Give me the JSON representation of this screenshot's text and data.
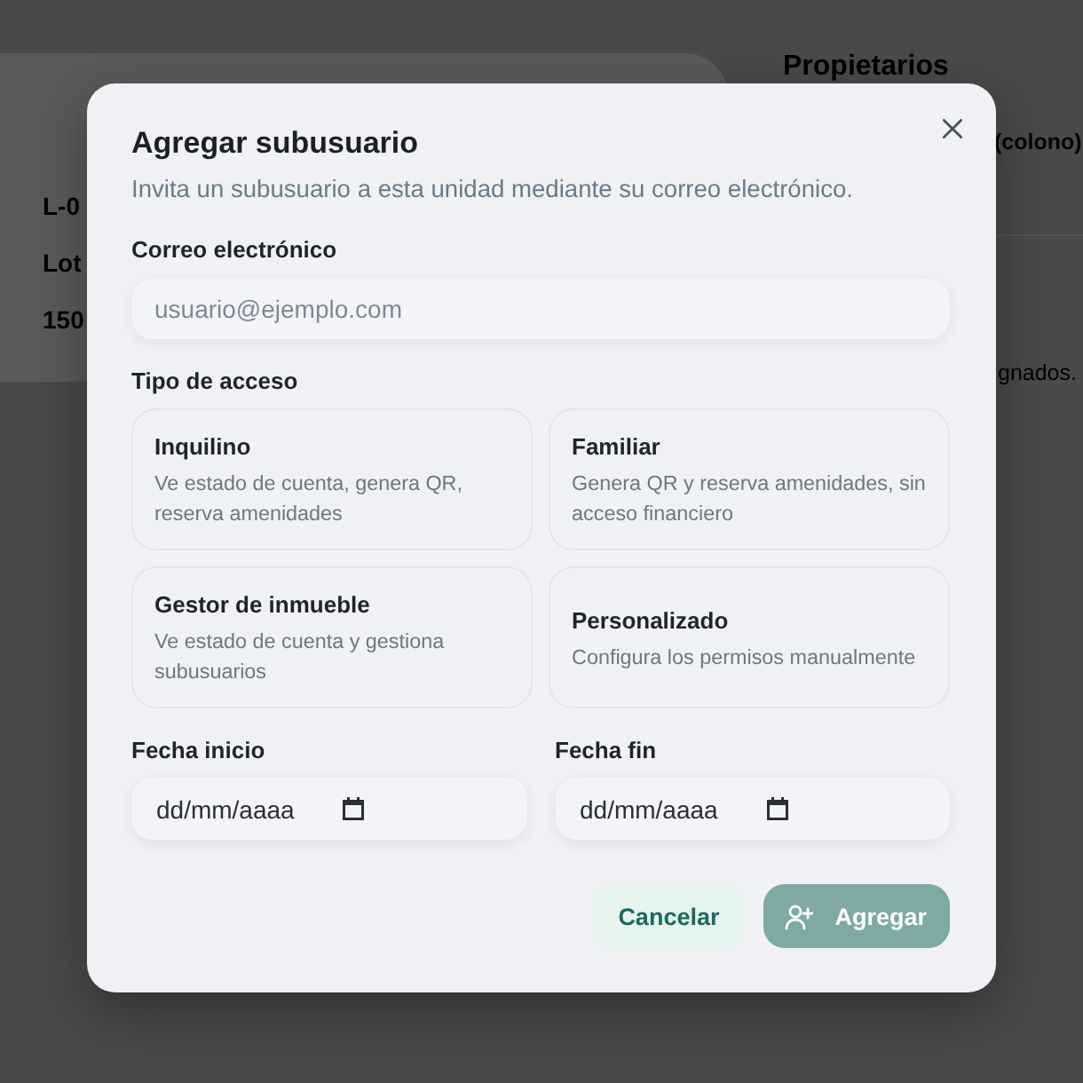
{
  "background": {
    "panel_lines": [
      "L-0",
      "Lot",
      "150"
    ],
    "heading": "Propietarios",
    "owner": "(colono)",
    "note": "gnados."
  },
  "dialog": {
    "title": "Agregar subusuario",
    "subtitle": "Invita un subusuario a esta unidad mediante su correo electrónico.",
    "email": {
      "label": "Correo electrónico",
      "placeholder": "usuario@ejemplo.com"
    },
    "access": {
      "label": "Tipo de acceso",
      "options": [
        {
          "title": "Inquilino",
          "description": "Ve estado de cuenta, genera QR, reserva amenidades",
          "selected": false
        },
        {
          "title": "Familiar",
          "description": "Genera QR y reserva amenidades, sin acceso financiero",
          "selected": false
        },
        {
          "title": "Gestor de inmueble",
          "description": "Ve estado de cuenta y gestiona subusuarios",
          "selected": false
        },
        {
          "title": "Personalizado",
          "description": "Configura los permisos manualmente",
          "selected": false
        }
      ]
    },
    "dates": [
      {
        "label": "Fecha inicio",
        "placeholder": "dd/mm/aaaa"
      },
      {
        "label": "Fecha fin",
        "placeholder": "dd/mm/aaaa"
      }
    ],
    "buttons": [
      {
        "kind": "secondary",
        "label": "Cancelar",
        "disabled": false
      },
      {
        "kind": "primary",
        "label": "Agregar",
        "disabled": true
      }
    ]
  }
}
